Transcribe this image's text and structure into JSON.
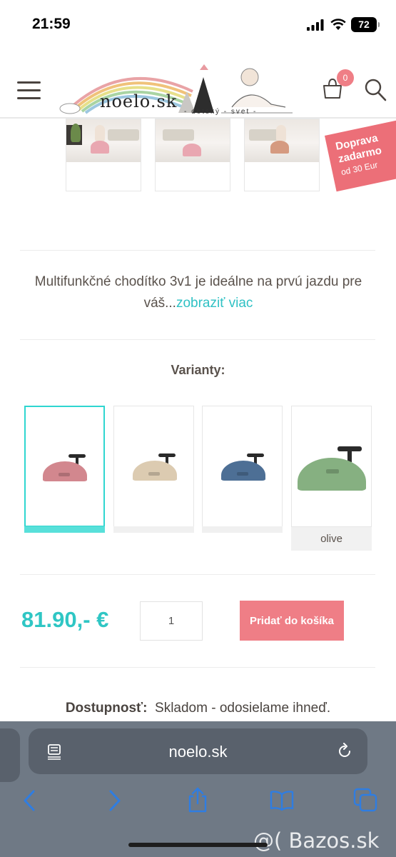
{
  "status_bar": {
    "time": "21:59",
    "battery": "72"
  },
  "header": {
    "logo_text": "noelo.sk",
    "logo_tagline": "- detský - svet -",
    "cart_count": "0"
  },
  "shipping_badge": {
    "line1": "Doprava",
    "line2": "zadarmo",
    "line3": "od 30 Eur"
  },
  "description": {
    "text": "Multifunkčné chodítko 3v1 je ideálne na prvú jazdu pre váš...",
    "link": "zobraziť viac"
  },
  "variants": {
    "title": "Varianty:",
    "items": [
      {
        "color": "#d2878e",
        "label": "",
        "selected": true
      },
      {
        "color": "#dccbb1",
        "label": ""
      },
      {
        "color": "#4d6f95",
        "label": ""
      },
      {
        "color": "#86b081",
        "label": "olive"
      }
    ]
  },
  "product": {
    "price": "81.90,- €",
    "quantity": "1",
    "add_to_cart": "Pridať do košíka"
  },
  "availability": {
    "label": "Dostupnosť:",
    "value": "Skladom - odosielame ihneď."
  },
  "browser": {
    "url": "noelo.sk"
  },
  "watermark": "@( Bazos.sk",
  "colors": {
    "accent": "#2fc6c4",
    "cta": "#ef7e86"
  }
}
